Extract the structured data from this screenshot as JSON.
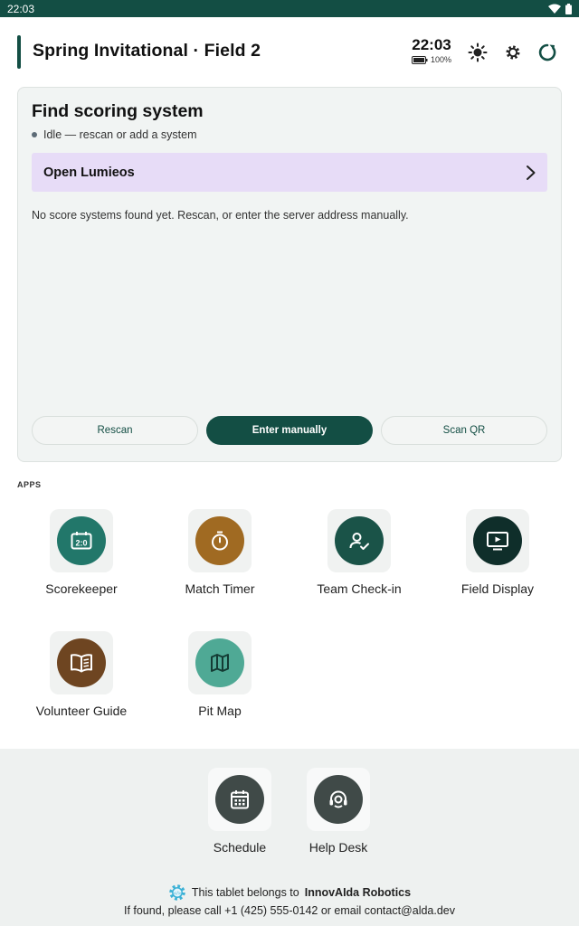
{
  "status_bar": {
    "time": "22:03"
  },
  "header": {
    "title": "Spring Invitational · Field 2",
    "clock_time": "22:03",
    "battery_pct": "100%"
  },
  "card": {
    "title": "Find scoring system",
    "status": "Idle — rescan or add a system",
    "open_label": "Open Lumieos",
    "empty_message": "No score systems found yet. Rescan, or enter the server address manually.",
    "buttons": {
      "rescan": "Rescan",
      "enter_manually": "Enter manually",
      "scan_qr": "Scan QR"
    }
  },
  "apps_section": {
    "label": "APPS",
    "items": [
      {
        "name": "Scorekeeper",
        "color": "#22776a",
        "icon": "scoreboard-icon"
      },
      {
        "name": "Match Timer",
        "color": "#a06a22",
        "icon": "stopwatch-icon"
      },
      {
        "name": "Team Check-in",
        "color": "#1a5348",
        "icon": "person-check-icon"
      },
      {
        "name": "Field Display",
        "color": "#0f2e2a",
        "icon": "display-icon"
      },
      {
        "name": "Volunteer Guide",
        "color": "#6e4521",
        "icon": "book-icon"
      },
      {
        "name": "Pit Map",
        "color": "#4fa995",
        "icon": "map-icon"
      }
    ]
  },
  "footer": {
    "apps": [
      {
        "name": "Schedule",
        "color": "#404a48",
        "icon": "calendar-icon"
      },
      {
        "name": "Help Desk",
        "color": "#404a48",
        "icon": "headset-icon"
      }
    ],
    "owner_prefix": "This tablet belongs to",
    "owner_name": "InnovAIda Robotics",
    "contact": "If found, please call +1 (425) 555-0142 or email contact@alda.dev"
  },
  "colors": {
    "accent": "#134e44",
    "open_row_bg": "#e7dcf7"
  }
}
